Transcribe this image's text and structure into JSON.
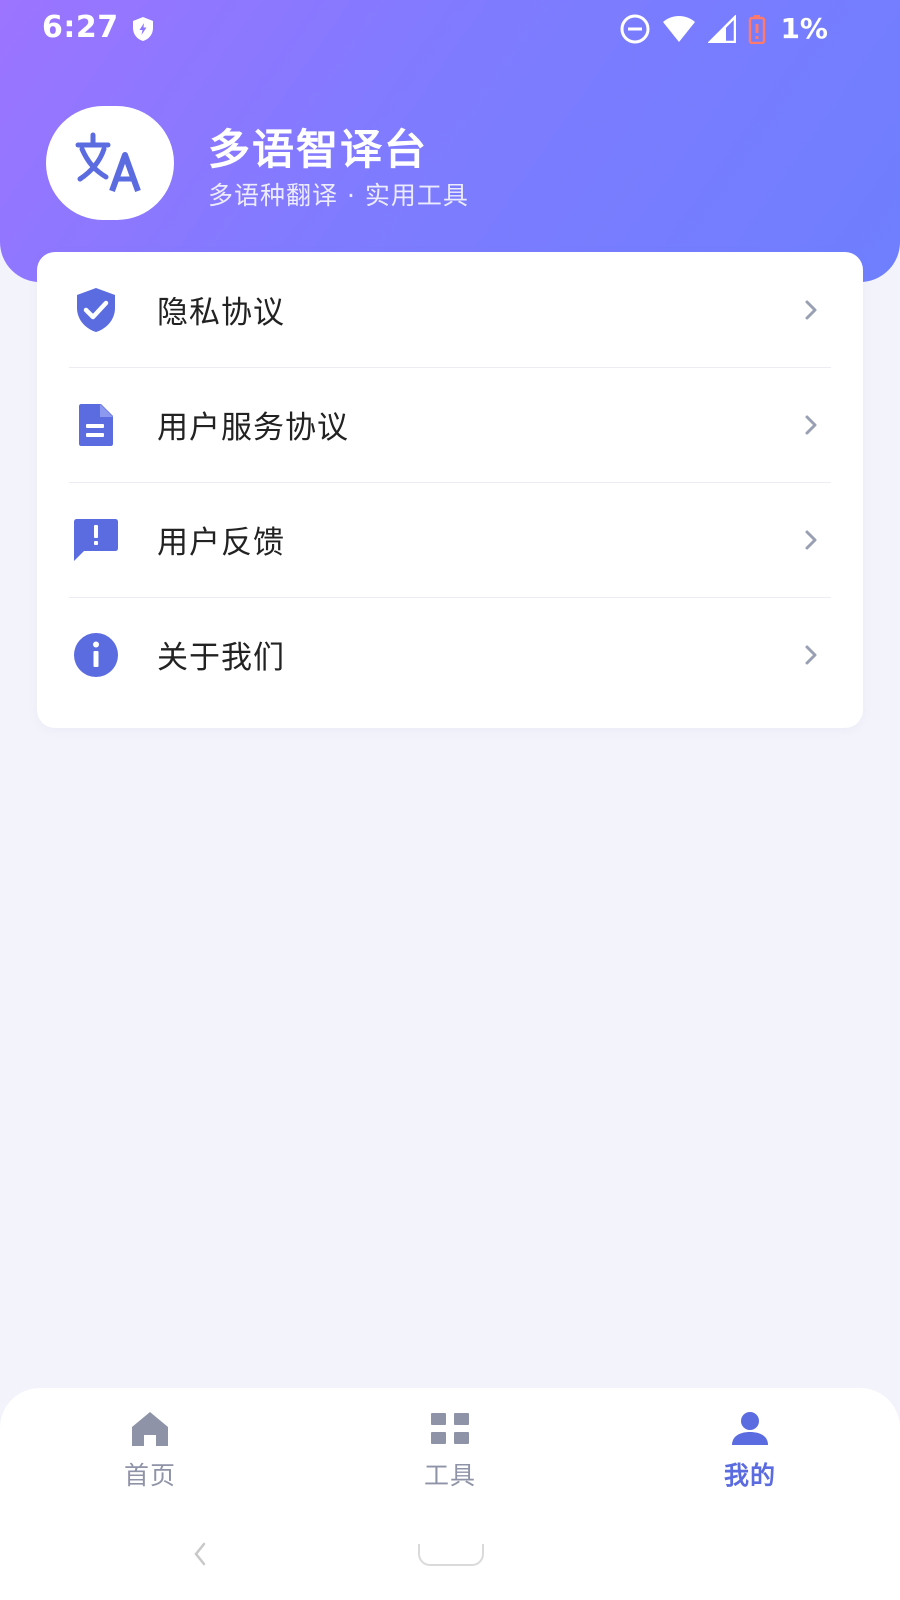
{
  "status_bar": {
    "time": "6:27",
    "battery_percent": "1%",
    "icons": [
      "shield-icon",
      "do-not-disturb-icon",
      "wifi-icon",
      "signal-icon",
      "battery-low-icon"
    ]
  },
  "header": {
    "app_name": "多语智译台",
    "subtitle": "多语种翻译 · 实用工具",
    "logo_icon": "translate-icon"
  },
  "menu": {
    "items": [
      {
        "label": "隐私协议",
        "icon": "shield-check-icon"
      },
      {
        "label": "用户服务协议",
        "icon": "document-icon"
      },
      {
        "label": "用户反馈",
        "icon": "feedback-icon"
      },
      {
        "label": "关于我们",
        "icon": "info-icon"
      }
    ]
  },
  "bottom_nav": {
    "items": [
      {
        "label": "首页",
        "icon": "home-icon",
        "active": false
      },
      {
        "label": "工具",
        "icon": "grid-icon",
        "active": false
      },
      {
        "label": "我的",
        "icon": "person-icon",
        "active": true
      }
    ]
  },
  "colors": {
    "accent": "#5b6be0",
    "header_gradient_start": "#9c74ff",
    "header_gradient_end": "#6e7ffe",
    "inactive_nav": "#8f93a8",
    "background": "#f3f3fb"
  }
}
